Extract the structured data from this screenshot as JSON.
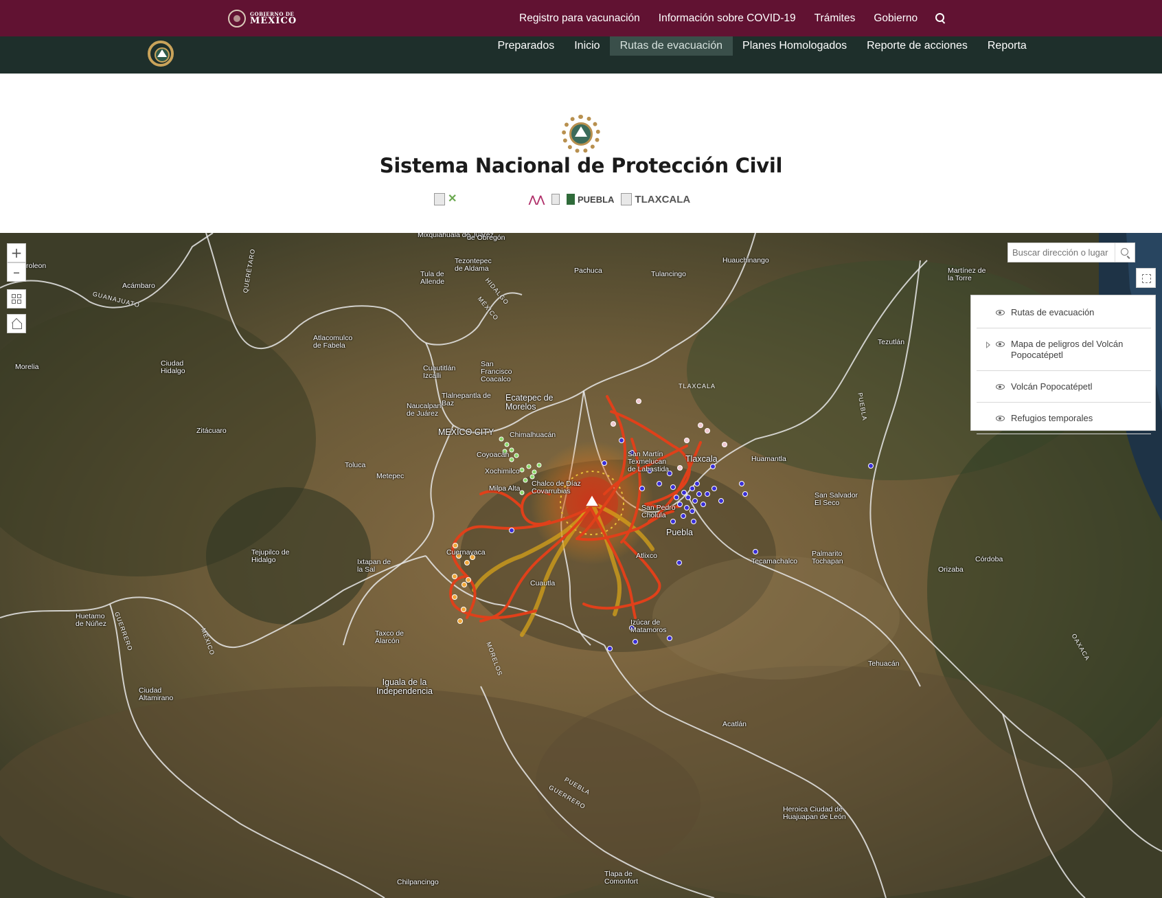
{
  "gov_bar": {
    "logo_small": "GOBIERNO DE",
    "logo_big": "MÉXICO",
    "links": [
      "Registro para vacunación",
      "Información sobre COVID-19",
      "Trámites",
      "Gobierno"
    ],
    "bg_color": "#611232"
  },
  "site_nav": {
    "items": [
      "Preparados",
      "Inicio",
      "Rutas de evacuación",
      "Planes Homologados",
      "Reporte de acciones",
      "Reporta"
    ],
    "active": "Rutas de evacuación",
    "bg_color": "#1e2f2b"
  },
  "header": {
    "title": "Sistema Nacional de Protección Civil",
    "logos": {
      "puebla": "PUEBLA",
      "tlaxcala": "TLAXCALA"
    }
  },
  "map": {
    "search_placeholder": "Buscar dirección o lugar",
    "zoom_in": "+",
    "zoom_out": "–",
    "layers": [
      {
        "label": "Rutas de evacuación",
        "expandable": false
      },
      {
        "label": "Mapa de peligros del Volcán Popocatépetl",
        "expandable": true
      },
      {
        "label": "Volcán Popocatépetl",
        "expandable": false
      },
      {
        "label": "Refugios temporales",
        "expandable": false
      }
    ],
    "places": [
      "Mixquiahuala de Juárez",
      "de Obregón",
      "Tezontepec de Aldama",
      "Pachuca",
      "Tulancingo",
      "Huauchinango",
      "Martínez de la Torre",
      "Acámbaro",
      "Tula de Allende",
      "Atlacomulco de Fabela",
      "Morelia",
      "Ciudad Hidalgo",
      "Cuautitlán Izcalli",
      "San Francisco Coacalco",
      "Tlalnepantla de Baz",
      "Ecatepec de Morelos",
      "Naucalpan de Juárez",
      "MEXICO CITY",
      "Chimalhuacán",
      "Coyoacán",
      "Xochimilco",
      "Chalco de Díaz Covarrubias",
      "Milpa Alta",
      "Zitácuaro",
      "Toluca",
      "Metepec",
      "San Martín Texmelucan de Labastida",
      "Tlaxcala",
      "Huamantla",
      "Tezutlán",
      "San Salvador El Seco",
      "San Pedro Cholula",
      "Puebla",
      "Atlixco",
      "Cuernavaca",
      "Tejupilco de Hidalgo",
      "Ixtapan de la Sal",
      "Cuautla",
      "Tecamachalco",
      "Palmarito Tochapan",
      "Orizaba",
      "Córdoba",
      "Izúcar de Matamoros",
      "Huetamo de Núñez",
      "Taxco de Alarcón",
      "Iguala de la Independencia",
      "Ciudad Altamirano",
      "Tehuacán",
      "Acatlán",
      "Heroica Ciudad de Huajuapan de León",
      "Chilpancingo",
      "Tlapa de Comonfort",
      "roleon"
    ],
    "state_labels": [
      "GUANAJUATO",
      "QUERÉTARO",
      "HIDALGO",
      "MÉXICO",
      "TLAXCALA",
      "PUEBLA",
      "MORELOS",
      "GUERRERO",
      "MÉXICO",
      "PUEBLA",
      "GUERRERO",
      "OAXACA"
    ]
  }
}
